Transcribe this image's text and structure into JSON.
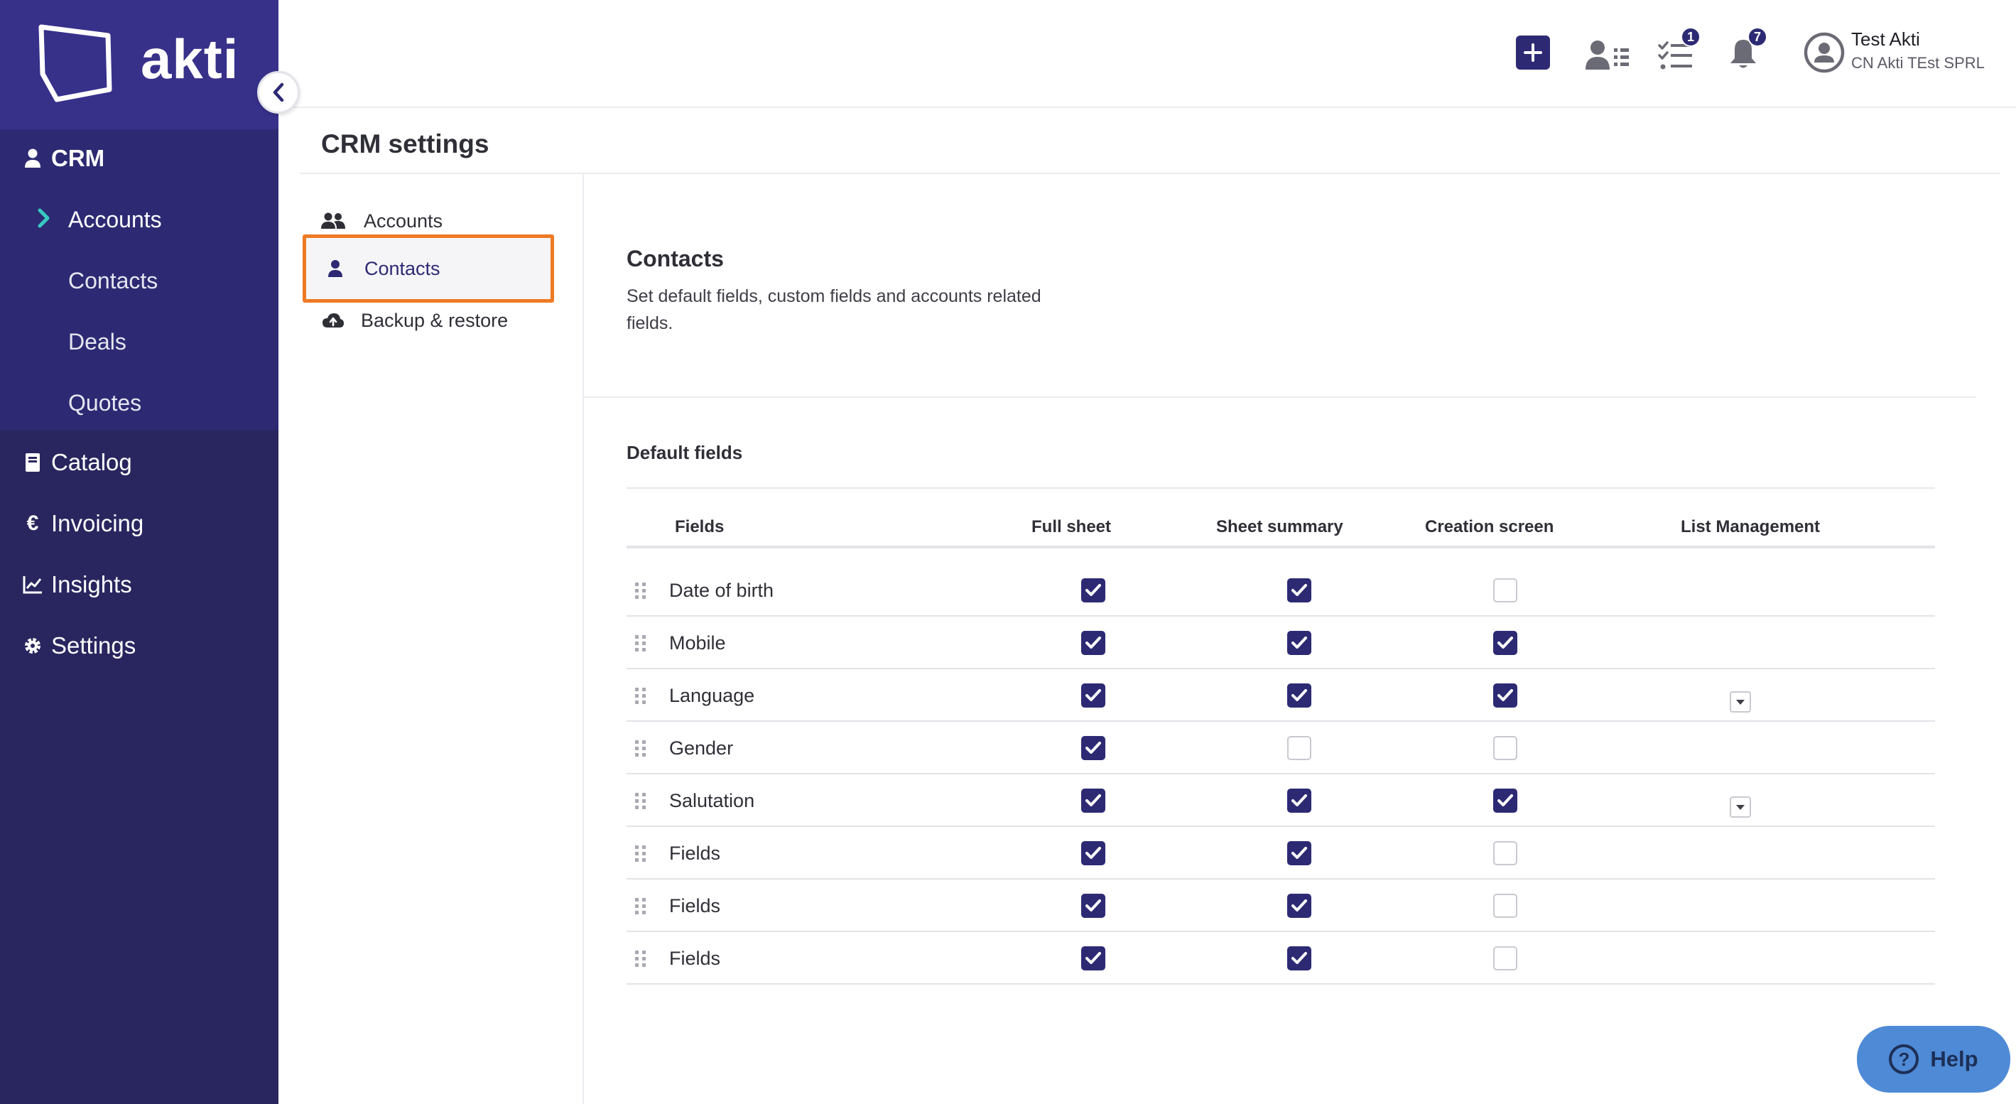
{
  "brand": {
    "name": "akti"
  },
  "sidebar": {
    "crm": {
      "label": "CRM"
    },
    "crm_items": [
      {
        "label": "Accounts",
        "expanded": true
      },
      {
        "label": "Contacts"
      },
      {
        "label": "Deals"
      },
      {
        "label": "Quotes"
      }
    ],
    "sections": [
      {
        "label": "Catalog",
        "icon": "book-icon"
      },
      {
        "label": "Invoicing",
        "icon": "euro-icon"
      },
      {
        "label": "Insights",
        "icon": "chart-icon"
      },
      {
        "label": "Settings",
        "icon": "gear-icon"
      }
    ]
  },
  "topbar": {
    "tasks_badge": "1",
    "notifications_badge": "7",
    "user": {
      "name": "Test Akti",
      "company": "CN Akti TEst SPRL"
    }
  },
  "page": {
    "title": "CRM settings"
  },
  "subnav": {
    "items": [
      {
        "label": "Accounts",
        "icon": "users-icon"
      },
      {
        "label": "Contacts",
        "icon": "user-icon",
        "selected": true
      },
      {
        "label": "Backup & restore",
        "icon": "cloud-upload-icon"
      }
    ]
  },
  "content": {
    "title": "Contacts",
    "description": "Set default fields, custom fields and accounts related fields.",
    "default_fields_title": "Default fields",
    "columns": [
      "Fields",
      "Full sheet",
      "Sheet summary",
      "Creation screen",
      "List Management"
    ],
    "rows": [
      {
        "name": "Date of birth",
        "full_sheet": true,
        "sheet_summary": true,
        "creation_screen": false,
        "list_management": false
      },
      {
        "name": "Mobile",
        "full_sheet": true,
        "sheet_summary": true,
        "creation_screen": true,
        "list_management": false
      },
      {
        "name": "Language",
        "full_sheet": true,
        "sheet_summary": true,
        "creation_screen": true,
        "list_management": true
      },
      {
        "name": "Gender",
        "full_sheet": true,
        "sheet_summary": false,
        "creation_screen": false,
        "list_management": false
      },
      {
        "name": "Salutation",
        "full_sheet": true,
        "sheet_summary": true,
        "creation_screen": true,
        "list_management": true
      },
      {
        "name": "Fields",
        "full_sheet": true,
        "sheet_summary": true,
        "creation_screen": false,
        "list_management": false
      },
      {
        "name": "Fields",
        "full_sheet": true,
        "sheet_summary": true,
        "creation_screen": false,
        "list_management": false
      },
      {
        "name": "Fields",
        "full_sheet": true,
        "sheet_summary": true,
        "creation_screen": false,
        "list_management": false
      }
    ]
  },
  "help": {
    "label": "Help"
  },
  "colors": {
    "brand_dark": "#29265f",
    "brand_header": "#37318a",
    "accent": "#2d2a73",
    "highlight": "#ee7a24",
    "help": "#4e8ad6"
  }
}
